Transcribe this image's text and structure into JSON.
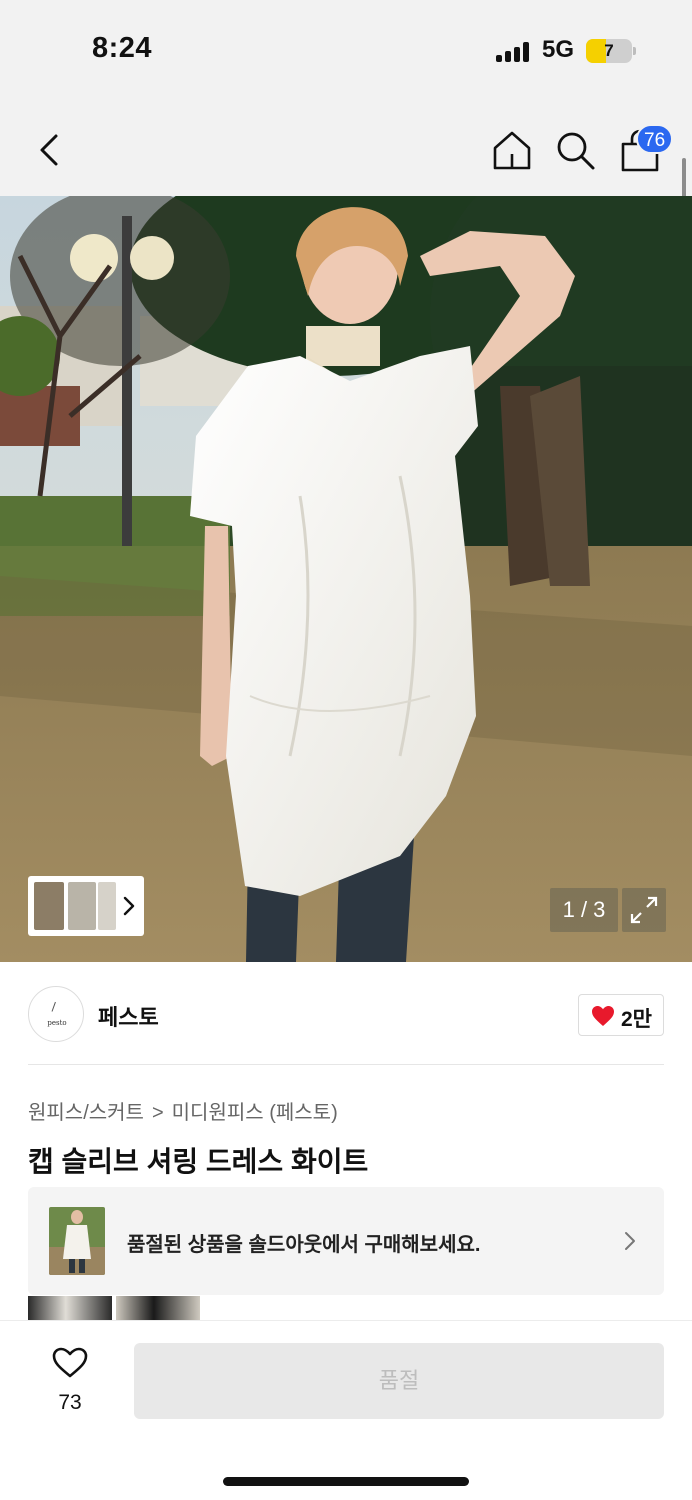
{
  "status_bar": {
    "time": "8:24",
    "network": "5G",
    "battery": "7"
  },
  "nav": {
    "cart_count": "76"
  },
  "hero": {
    "counter": "1 / 3"
  },
  "brand": {
    "logo_text": "pesto",
    "name": "페스토",
    "like_count": "2만"
  },
  "breadcrumb": {
    "category": "원피스/스커트",
    "separator": ">",
    "subcategory": "미디원피스 (페스토)"
  },
  "product": {
    "title": "캡 슬리브 셔링 드레스 화이트"
  },
  "soldout": {
    "message": "품절된 상품을 솔드아웃에서 구매해보세요."
  },
  "bottom_bar": {
    "wish_count": "73",
    "buy_label": "품절"
  },
  "colors": {
    "accent_blue": "#2b68f0",
    "heart_red": "#e8192c",
    "disabled_bg": "#e8e8e8"
  }
}
